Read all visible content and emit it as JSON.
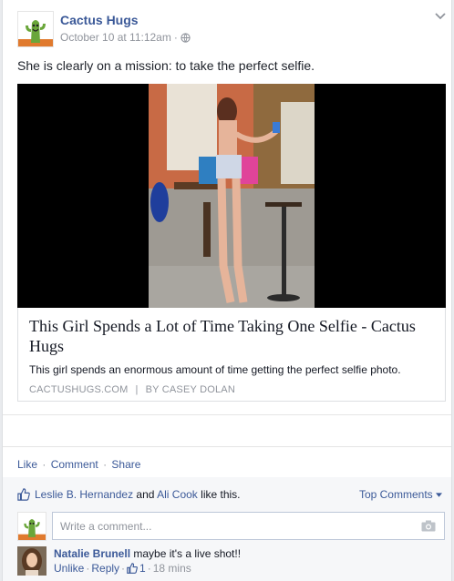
{
  "post": {
    "author": "Cactus Hugs",
    "timestamp": "October 10 at 11:12am",
    "meta_separator": "·",
    "privacy_icon": "globe-icon",
    "text": "She is clearly on a mission: to take the perfect selfie."
  },
  "link": {
    "title": "This Girl Spends a Lot of Time Taking One Selfie - Cactus Hugs",
    "description": "This girl spends an enormous amount of time getting the perfect selfie photo.",
    "domain": "CACTUSHUGS.COM",
    "separator": "|",
    "byline": "BY CASEY DOLAN"
  },
  "actions": {
    "like": "Like",
    "comment": "Comment",
    "share": "Share",
    "separator": "·"
  },
  "ufi": {
    "liker1": "Leslie B. Hernandez",
    "and_text": "and",
    "liker2": "Ali Cook",
    "like_suffix": "like this.",
    "top_comments": "Top Comments",
    "comment_placeholder": "Write a comment..."
  },
  "comment": {
    "author": "Natalie Brunell",
    "text": "maybe it's a live shot!!",
    "unlike": "Unlike",
    "reply": "Reply",
    "like_count": "1",
    "time": "18 mins",
    "separator": "·"
  },
  "colors": {
    "link_blue": "#3b5998",
    "muted_gray": "#90949c",
    "background": "#e9ebee"
  }
}
